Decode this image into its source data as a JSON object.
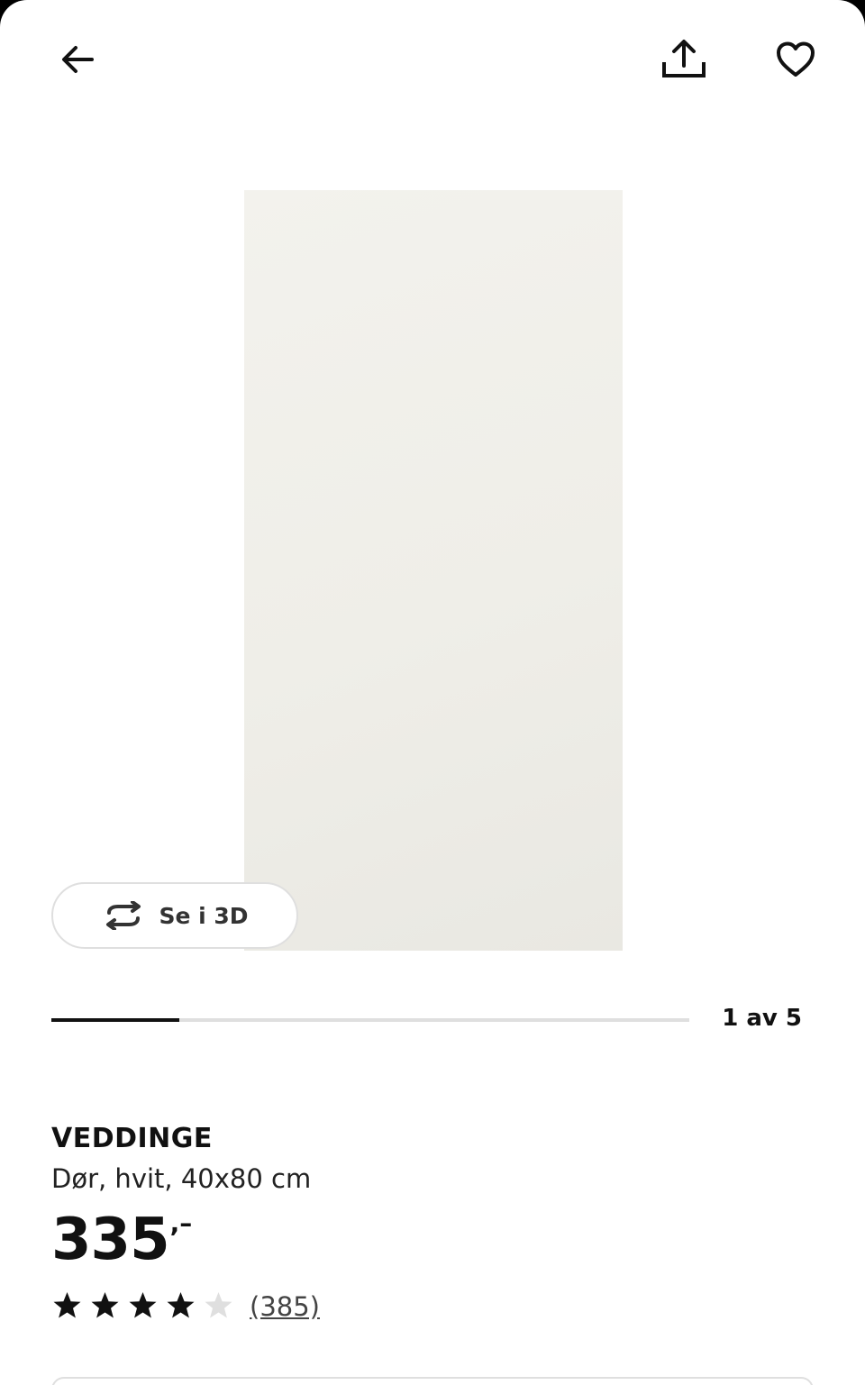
{
  "header": {
    "back_icon": "arrow-left-icon",
    "share_icon": "share-icon",
    "favorite_icon": "heart-outline-icon"
  },
  "gallery": {
    "view_3d_label": "Se i 3D",
    "view_3d_icon": "rotate-3d-icon",
    "current_index": 1,
    "total": 5,
    "progress_fraction": 0.2,
    "counter_text": "1 av 5",
    "image_color": "#efeee8"
  },
  "product": {
    "name": "VEDDINGE",
    "description": "Dør, hvit, 40x80 cm",
    "price": "335",
    "price_suffix": ",–"
  },
  "rating": {
    "stars_filled": 4,
    "stars_total": 5,
    "review_count": "(385)",
    "star_color": "#111111",
    "star_empty_color": "#dfdfdf"
  }
}
